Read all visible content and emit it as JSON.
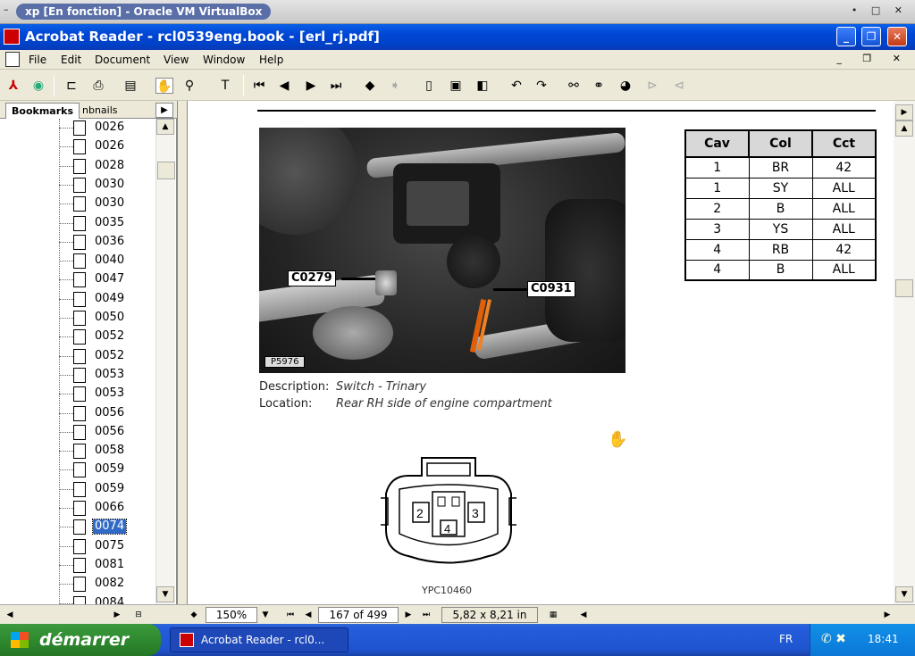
{
  "vbox": {
    "menu": "–",
    "title": "xp [En fonction] - Oracle VM VirtualBox",
    "controls": "• □ ✕"
  },
  "app": {
    "title": "Acrobat Reader - rcl0539eng.book - [erl_rj.pdf]",
    "min": "_",
    "max": "❐",
    "close": "✕"
  },
  "menu": {
    "items": [
      "File",
      "Edit",
      "Document",
      "View",
      "Window",
      "Help"
    ],
    "mdi": "_ ❐ ✕"
  },
  "toolbar": {
    "icons": [
      "acrobat-icon",
      "web-capture-icon",
      "open-icon",
      "print-icon",
      "show-hide-navigation-icon",
      "hand-tool-icon",
      "zoom-tool-icon",
      "text-select-icon",
      "first-page-icon",
      "previous-page-icon",
      "next-page-icon",
      "last-page-icon",
      "go-back-icon",
      "go-forward-icon",
      "actual-size-icon",
      "fit-page-icon",
      "fit-width-icon",
      "rotate-left-icon",
      "rotate-right-icon",
      "find-icon",
      "search-icon",
      "search-results-icon",
      "previous-highlight-icon",
      "next-highlight-icon"
    ]
  },
  "sidebar": {
    "tab_bookmarks": "Bookmarks",
    "tab_thumbnails": "nbnails",
    "bookmarks": [
      "0026",
      "0026",
      "0028",
      "0030",
      "0030",
      "0035",
      "0036",
      "0040",
      "0047",
      "0049",
      "0050",
      "0052",
      "0052",
      "0053",
      "0053",
      "0056",
      "0056",
      "0058",
      "0059",
      "0059",
      "0066",
      "0074",
      "0075",
      "0081",
      "0082",
      "0084"
    ],
    "selected_index": 21
  },
  "document": {
    "callout_left": "C0279",
    "callout_right": "C0931",
    "photo_label": "P5976",
    "description_label": "Description:",
    "description_value": "Switch - Trinary",
    "location_label": "Location:",
    "location_value": "Rear RH side of engine compartment",
    "table": {
      "headers": [
        "Cav",
        "Col",
        "Cct"
      ],
      "rows": [
        [
          "1",
          "BR",
          "42"
        ],
        [
          "1",
          "SY",
          "ALL"
        ],
        [
          "2",
          "B",
          "ALL"
        ],
        [
          "3",
          "YS",
          "ALL"
        ],
        [
          "4",
          "RB",
          "42"
        ],
        [
          "4",
          "B",
          "ALL"
        ]
      ]
    },
    "connector_pins": [
      "2",
      "3",
      "4"
    ],
    "connector_label": "YPC10460"
  },
  "status": {
    "zoom": "150%",
    "page": "167 of 499",
    "size": "5,82 x 8,21 in"
  },
  "taskbar": {
    "start": "démarrer",
    "task": "Acrobat Reader - rcl0...",
    "lang": "FR",
    "clock": "18:41"
  }
}
